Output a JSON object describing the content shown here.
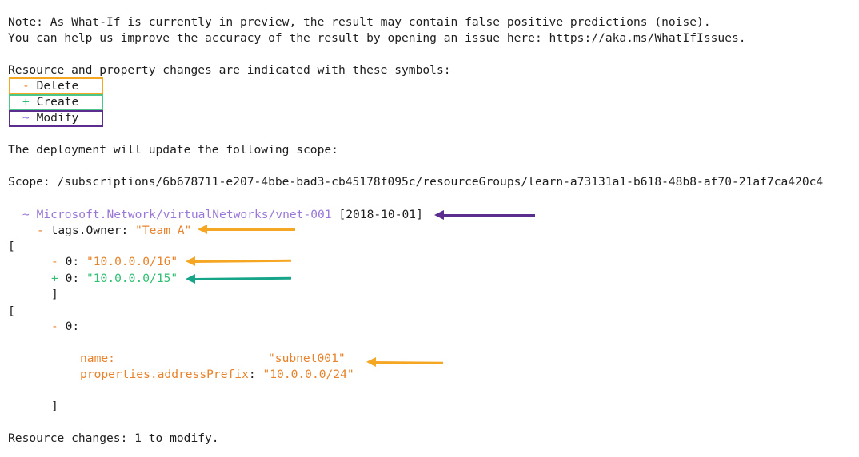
{
  "note": {
    "line1": "Note: As What-If is currently in preview, the result may contain false positive predictions (noise).",
    "line2": "You can help us improve the accuracy of the result by opening an issue here: https://aka.ms/WhatIfIssues."
  },
  "legend": {
    "intro": "Resource and property changes are indicated with these symbols:",
    "items": [
      {
        "symbol": "-",
        "label": "Delete",
        "color": "#e9822a",
        "box_color": "#f5a623"
      },
      {
        "symbol": "+",
        "label": "Create",
        "color": "#2fbf71",
        "box_color": "#4cc68b"
      },
      {
        "symbol": "~",
        "label": "Modify",
        "color": "#9a78d8",
        "box_color": "#5b2d8e"
      }
    ]
  },
  "scope": {
    "intro": "The deployment will update the following scope:",
    "line": "Scope: /subscriptions/6b678711-e207-4bbe-bad3-cb45178f095c/resourceGroups/learn-a73131a1-b618-48b8-af70-21af7ca420c4"
  },
  "resource": {
    "symbol": "~",
    "id": "Microsoft.Network/virtualNetworks/vnet-001",
    "api_version": "[2018-10-01]",
    "tag_change": {
      "symbol": "-",
      "path": "tags.Owner:",
      "value": "\"Team A\""
    },
    "address_array": {
      "open": "[",
      "delete": {
        "symbol": "-",
        "index": "0:",
        "value": "\"10.0.0.0/16\""
      },
      "create": {
        "symbol": "+",
        "index": "0:",
        "value": "\"10.0.0.0/15\""
      },
      "close": "]"
    },
    "subnet_array": {
      "open": "[",
      "delete": {
        "symbol": "-",
        "index": "0:"
      },
      "name_key": "name:",
      "name_value": "\"subnet001\"",
      "prefix_key": "properties.addressPrefix",
      "prefix_colon": ":",
      "prefix_value": "\"10.0.0.0/24\"",
      "close": "]"
    }
  },
  "summary": "Resource changes: 1 to modify.",
  "annotation_colors": {
    "delete": "#f5a623",
    "create": "#17a589",
    "modify": "#5b2d8e"
  }
}
